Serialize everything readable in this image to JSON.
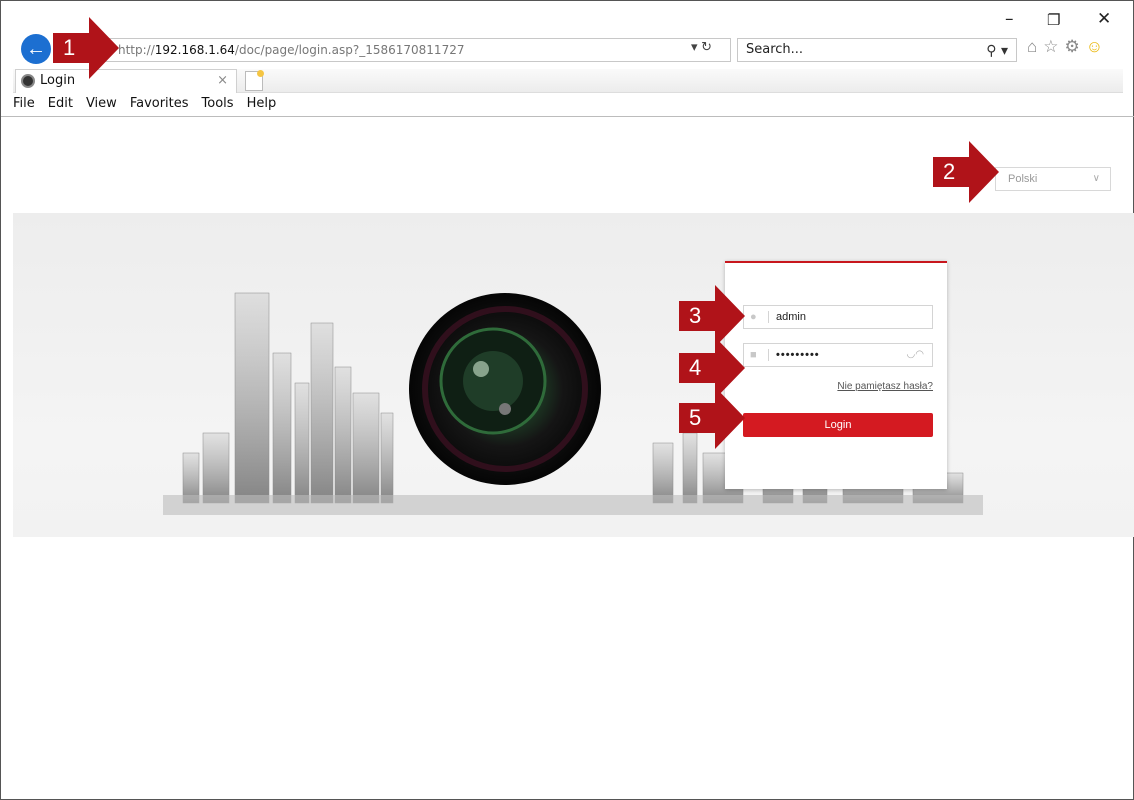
{
  "window": {
    "controls": {
      "minimize": "–",
      "restore": "❐",
      "close": "✕"
    }
  },
  "browser": {
    "url_prefix": "http://",
    "url_host": "192.168.1.64",
    "url_path": "/doc/page/login.asp?_1586170811727",
    "search_placeholder": "Search...",
    "address_tools": "▾ ↻",
    "search_icon": "⚲ ▾",
    "toolbar_icons": [
      "home-icon",
      "favorites-star-icon",
      "settings-gear-icon",
      "feedback-smiley-icon"
    ],
    "toolbar_glyphs": {
      "home": "⌂",
      "star": "☆",
      "gear": "⚙",
      "smiley": "☺"
    }
  },
  "tabs": [
    {
      "label": "Login",
      "close": "×"
    }
  ],
  "menu": [
    "File",
    "Edit",
    "View",
    "Favorites",
    "Tools",
    "Help"
  ],
  "page": {
    "language": "Polski",
    "language_chevron": "∨",
    "login": {
      "username": "admin",
      "password": "•••••••••",
      "forgot": "Nie pamiętasz hasła?",
      "button": "Login"
    }
  },
  "annotations": [
    "1",
    "2",
    "3",
    "4",
    "5"
  ],
  "colors": {
    "accent_red": "#d41a21",
    "annotation_red": "#b01319",
    "ie_blue": "#1c6fd1"
  }
}
